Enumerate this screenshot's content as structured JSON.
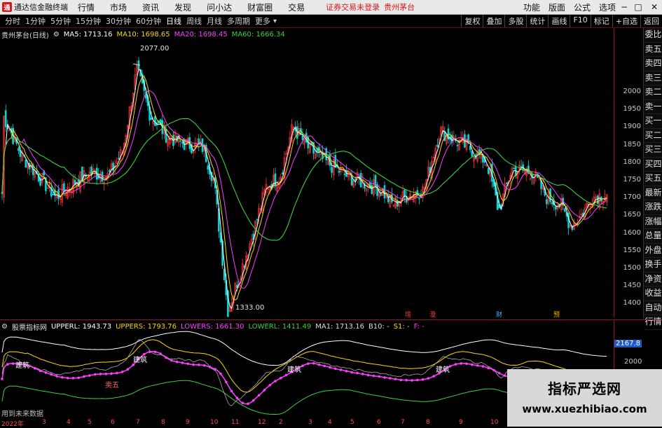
{
  "app": {
    "title": "通达信金融终端",
    "menus": [
      "行情",
      "市场",
      "资讯",
      "发现",
      "问小达",
      "财富圈",
      "交易"
    ],
    "notice": "证券交易未登录",
    "stock_name": "贵州茅台",
    "right_menus": [
      "功能",
      "版面",
      "公式",
      "选项"
    ],
    "window_controls": [
      "−",
      "□",
      "✕"
    ]
  },
  "toolbar": {
    "periods": [
      "分时",
      "1分钟",
      "5分钟",
      "15分钟",
      "30分钟",
      "60分钟",
      "日线",
      "周线",
      "月线",
      "多周期",
      "更多"
    ],
    "right_buttons": [
      "复权",
      "叠加",
      "多股",
      "统计",
      "画线",
      "F10",
      "标记",
      "+自选",
      "返回"
    ]
  },
  "main": {
    "stock_label": "贵州茅台(日线)",
    "ma": [
      {
        "label": "MA5: 1713.16",
        "color": "#ffffff"
      },
      {
        "label": "MA10: 1698.65",
        "color": "#ffd700"
      },
      {
        "label": "MA20: 1698.45",
        "color": "#ff3cff"
      },
      {
        "label": "MA60: 1666.34",
        "color": "#3cd03c"
      }
    ],
    "high_label": "2077.00",
    "low_label": "1333.00",
    "price_ticks": [
      "2000",
      "1950",
      "1900",
      "1850",
      "1800",
      "1750",
      "1700",
      "1650",
      "1600",
      "1550",
      "1500",
      "1450",
      "1400"
    ],
    "event_marks": [
      "增",
      "澄",
      "财",
      "预"
    ]
  },
  "sidebar": {
    "items": [
      "委比",
      "卖五",
      "卖四",
      "卖三",
      "卖二",
      "卖一",
      "买一",
      "买二",
      "买三",
      "买四",
      "买五",
      "最新",
      "涨跌",
      "涨幅",
      "总量",
      "外盘",
      "换手",
      "净资",
      "收益",
      "自动",
      "行情"
    ]
  },
  "indicator": {
    "name": "股票指标网",
    "values": [
      {
        "label": "UPPERL: 1943.73",
        "color": "#ffffff"
      },
      {
        "label": "UPPERS: 1793.76",
        "color": "#ffd700"
      },
      {
        "label": "LOWERS: 1661.30",
        "color": "#ff3cff"
      },
      {
        "label": "LOWERL: 1411.49",
        "color": "#3cd03c"
      },
      {
        "label": "MA1: 1713.16",
        "color": "#dddddd"
      },
      {
        "label": "B10: -",
        "color": "#dddddd"
      },
      {
        "label": "S1: -",
        "color": "#ffd700"
      },
      {
        "label": "F: -",
        "color": "#ff3cff"
      }
    ],
    "signal_labels": [
      "建筑",
      "建筑",
      "建筑",
      "建筑",
      "卖五"
    ],
    "axis_current": "2167.8",
    "axis_tick": "2000",
    "note": "用到未来数据"
  },
  "date_axis": {
    "labels": [
      "2022年",
      "3",
      "4",
      "5",
      "6",
      "7",
      "8",
      "9",
      "10",
      "11",
      "12",
      "2",
      "3",
      "4",
      "5",
      "6",
      "7",
      "8",
      "9",
      "10"
    ]
  },
  "watermark": {
    "line1": "指标严选网",
    "line2": "www.xuezhibiao.com"
  }
}
